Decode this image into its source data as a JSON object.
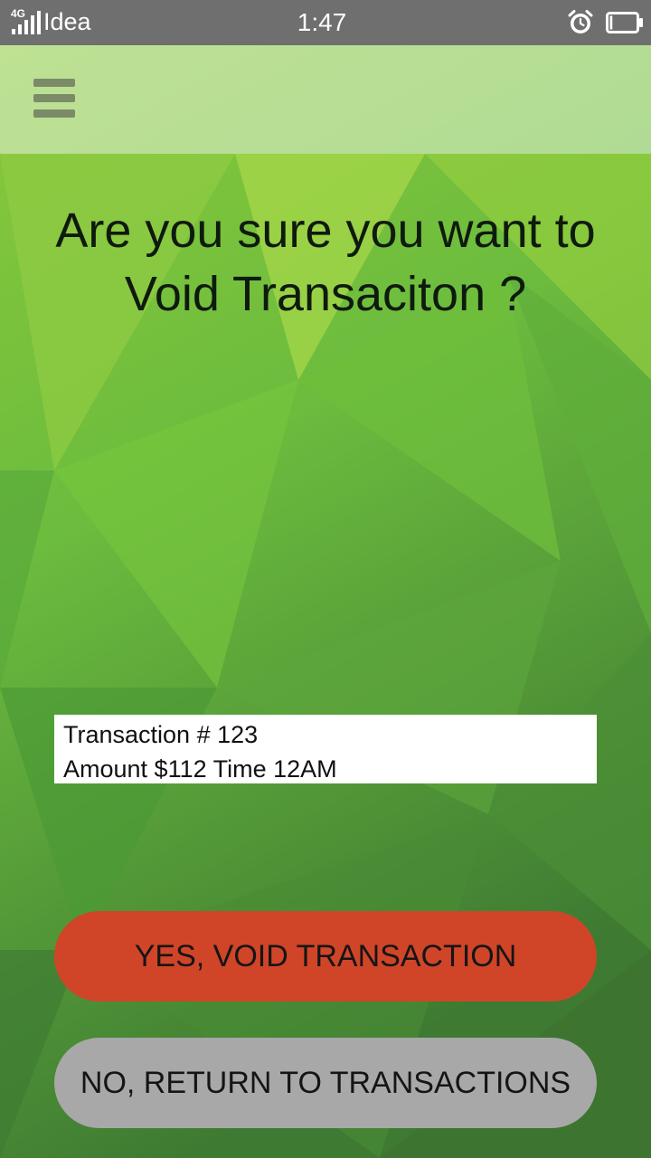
{
  "status_bar": {
    "network_type": "4G",
    "carrier": "Idea",
    "time": "1:47",
    "icons": [
      "signal-icon",
      "alarm-clock-icon",
      "battery-icon"
    ],
    "battery_level": 0.1
  },
  "header": {
    "menu_icon": "hamburger-menu-icon"
  },
  "dialog": {
    "question": "Are you sure you want to Void Transaciton ?"
  },
  "transaction": {
    "line1": "Transaction # 123",
    "line2": "Amount $112 Time 12AM"
  },
  "actions": {
    "confirm_label": "YES, VOID TRANSACTION",
    "cancel_label": "NO, RETURN TO TRANSACTIONS"
  },
  "colors": {
    "status_bar": "#6f6f6f",
    "background_green": "#6cb843",
    "confirm_button": "#d04528",
    "cancel_button": "#a8a8a8",
    "menu_icon": "#7b8b68"
  }
}
